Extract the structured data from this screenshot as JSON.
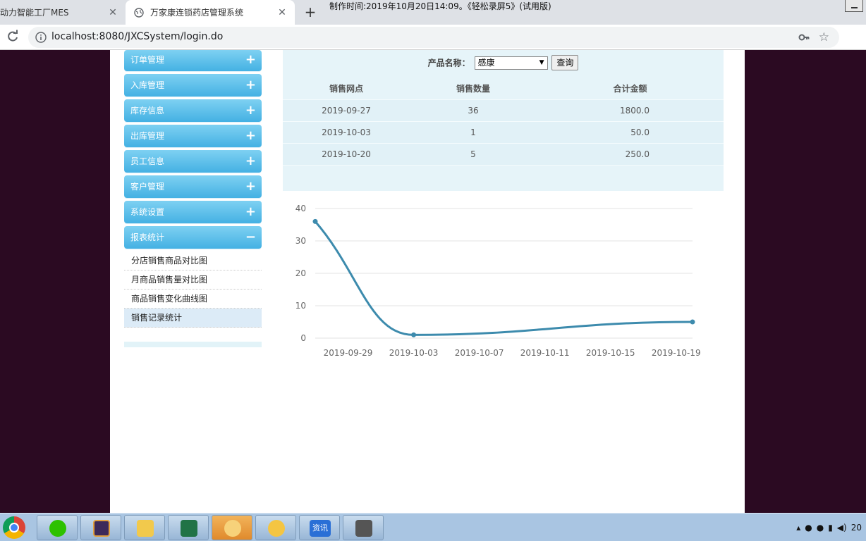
{
  "browser": {
    "tabs": [
      {
        "title": "动力智能工厂MES",
        "active": false
      },
      {
        "title": "万家康连锁药店管理系统",
        "active": true
      }
    ],
    "caption": "制作时间:2019年10月20日14:09。《轻松录屏5》(试用版)",
    "url": "localhost:8080/JXCSystem/login.do"
  },
  "sidebar": {
    "items": [
      {
        "label": "订单管理",
        "toggle": "+"
      },
      {
        "label": "入库管理",
        "toggle": "+"
      },
      {
        "label": "库存信息",
        "toggle": "+"
      },
      {
        "label": "出库管理",
        "toggle": "+"
      },
      {
        "label": "员工信息",
        "toggle": "+"
      },
      {
        "label": "客户管理",
        "toggle": "+"
      },
      {
        "label": "系统设置",
        "toggle": "+"
      },
      {
        "label": "报表统计",
        "toggle": "−"
      }
    ],
    "subitems": [
      {
        "label": "分店销售商品对比图"
      },
      {
        "label": "月商品销售量对比图"
      },
      {
        "label": "商品销售变化曲线图"
      },
      {
        "label": "销售记录统计"
      }
    ]
  },
  "query": {
    "label": "产品名称：",
    "selected": "感康",
    "button": "查询"
  },
  "table": {
    "headers": [
      "销售网点",
      "销售数量",
      "合计金额"
    ],
    "rows": [
      [
        "2019-09-27",
        "36",
        "1800.0"
      ],
      [
        "2019-10-03",
        "1",
        "50.0"
      ],
      [
        "2019-10-20",
        "5",
        "250.0"
      ]
    ]
  },
  "chart_data": {
    "type": "line",
    "x": [
      "2019-09-27",
      "2019-10-03",
      "2019-10-20"
    ],
    "values": [
      36,
      1,
      5
    ],
    "x_ticks": [
      "2019-09-29",
      "2019-10-03",
      "2019-10-07",
      "2019-10-11",
      "2019-10-15",
      "2019-10-19"
    ],
    "y_ticks": [
      0,
      10,
      20,
      30,
      40
    ],
    "ylim": [
      0,
      40
    ],
    "color": "#3d8bad",
    "grid": true
  },
  "taskbar": {
    "apps": [
      "chrome-icon",
      "wechat-icon",
      "javaee-ide-icon",
      "file-explorer-icon",
      "excel-icon",
      "package-icon",
      "hand-icon",
      "news-icon",
      "settings-tool-icon"
    ],
    "news_label": "资讯",
    "ide_label": "Java EE IDE",
    "clock": "20"
  }
}
